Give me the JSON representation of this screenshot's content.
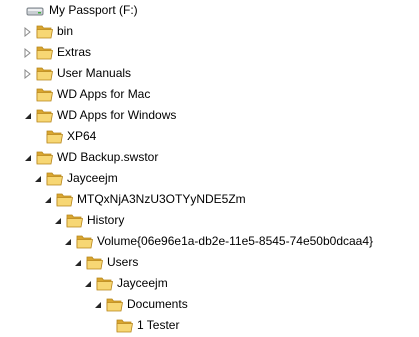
{
  "tree": {
    "drive": {
      "label": "My Passport (F:)",
      "icon": "drive-icon"
    },
    "items": [
      {
        "label": "bin",
        "icon": "folder-icon",
        "expander": "collapsed"
      },
      {
        "label": "Extras",
        "icon": "folder-icon",
        "expander": "collapsed"
      },
      {
        "label": "User Manuals",
        "icon": "folder-icon",
        "expander": "collapsed"
      },
      {
        "label": "WD Apps for Mac",
        "icon": "folder-icon",
        "expander": "none"
      },
      {
        "label": "WD Apps for Windows",
        "icon": "folder-icon",
        "expander": "expanded"
      },
      {
        "label": "XP64",
        "icon": "folder-icon",
        "expander": "none"
      },
      {
        "label": "WD Backup.swstor",
        "icon": "folder-icon",
        "expander": "expanded"
      },
      {
        "label": "Jayceejm",
        "icon": "folder-icon",
        "expander": "expanded"
      },
      {
        "label": "MTQxNjA3NzU3OTYyNDE5Zm",
        "icon": "folder-icon",
        "expander": "expanded"
      },
      {
        "label": "History",
        "icon": "folder-icon",
        "expander": "expanded"
      },
      {
        "label": "Volume{06e96e1a-db2e-11e5-8545-74e50b0dcaa4}",
        "icon": "folder-icon",
        "expander": "expanded"
      },
      {
        "label": "Users",
        "icon": "folder-icon",
        "expander": "expanded"
      },
      {
        "label": "Jayceejm",
        "icon": "folder-icon",
        "expander": "expanded"
      },
      {
        "label": "Documents",
        "icon": "folder-icon",
        "expander": "expanded"
      },
      {
        "label": "1 Tester",
        "icon": "folder-icon",
        "expander": "none"
      }
    ]
  },
  "colors": {
    "folder_back": "#d9a630",
    "folder_front": "#f7d774",
    "folder_edge": "#b8861b",
    "arrow_collapsed": "#8a8a8a",
    "arrow_expanded": "#262626",
    "drive_body": "#c9ced3"
  }
}
